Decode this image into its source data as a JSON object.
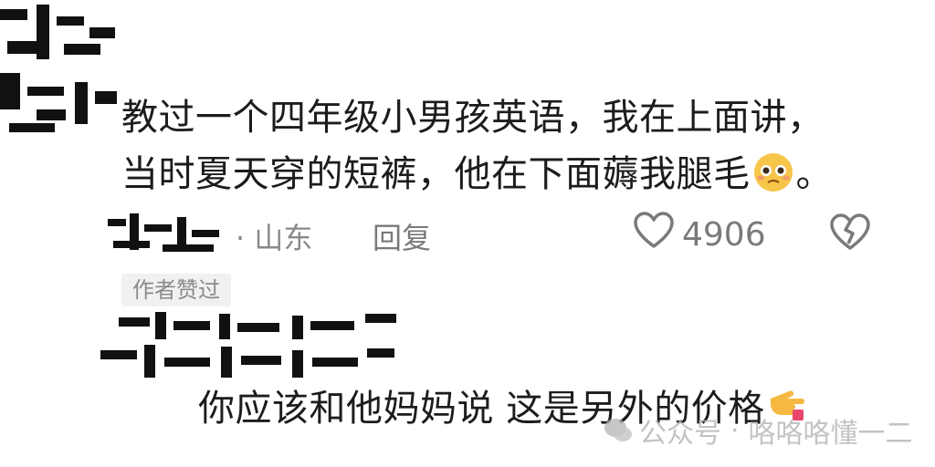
{
  "comment": {
    "text_line1": "教过一个四年级小男孩英语，我在上面讲，",
    "text_line2_before": "当时夏天穿的短裤，他在下面薅我腿毛",
    "text_line2_after": "。",
    "emoji_icon": "pleading-face-icon",
    "location": "· 山东",
    "reply_label": "回复",
    "like_count": "4906",
    "author_badge": "作者赞过"
  },
  "reply": {
    "text": "你应该和他妈妈说 这是另外的价格",
    "emoji_icon": "pointing-hand-icon"
  },
  "watermark": {
    "label": "公众号",
    "author": "咯咯咯懂一二"
  },
  "colors": {
    "text": "#1c1c1c",
    "meta": "#8a8a8a",
    "badge_bg": "#f1f1f1"
  }
}
